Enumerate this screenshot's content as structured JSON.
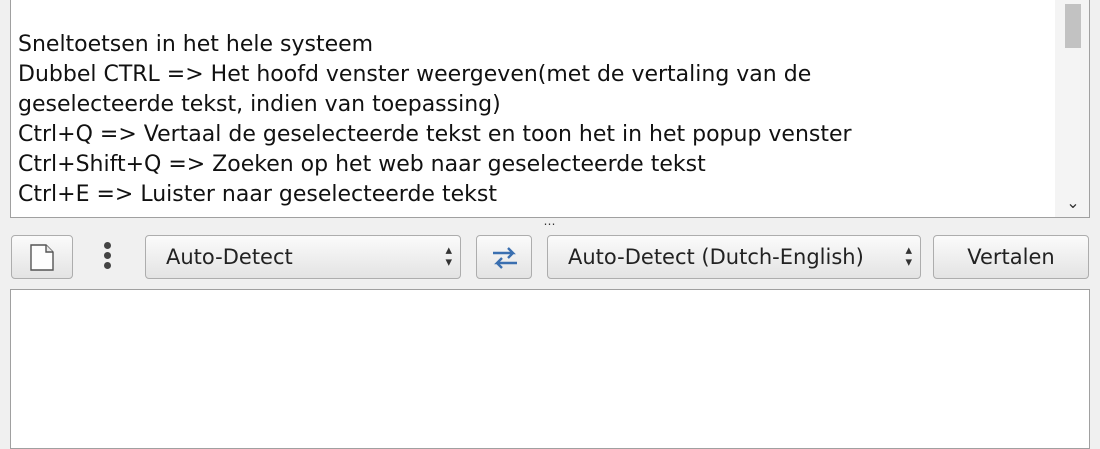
{
  "source": {
    "lines": [
      "Sneltoetsen in het hele systeem",
      "Dubbel CTRL => Het hoofd venster weergeven(met de vertaling van de",
      "geselecteerde tekst, indien van toepassing)",
      "Ctrl+Q => Vertaal de geselecteerde tekst en toon het in het popup venster",
      "Ctrl+Shift+Q => Zoeken op het web naar geselecteerde tekst",
      "Ctrl+E => Luister naar geselecteerde tekst"
    ]
  },
  "toolbar": {
    "source_language": "Auto-Detect",
    "target_language": "Auto-Detect (Dutch-English)",
    "translate_label": "Vertalen",
    "icons": {
      "new": "document-icon",
      "more": "vertical-dots-icon",
      "swap": "swap-arrows-icon"
    }
  },
  "result": {
    "text": ""
  },
  "colors": {
    "accent_blue": "#3a6fb0",
    "panel_border": "#a0a0a0"
  }
}
